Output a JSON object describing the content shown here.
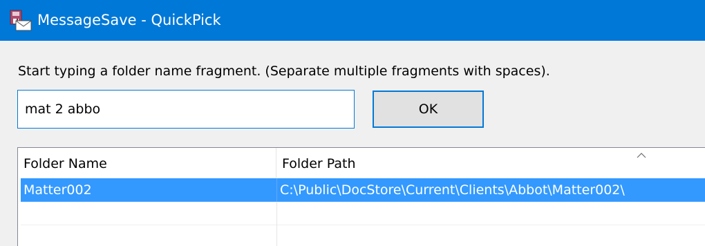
{
  "window": {
    "title": "MessageSave - QuickPick",
    "app_icon": "messagesave-envelope-icon"
  },
  "instruction": "Start typing a folder name fragment. (Separate multiple fragments with spaces).",
  "search": {
    "value": "mat 2 abbo",
    "placeholder": ""
  },
  "ok_button": {
    "label": "OK"
  },
  "list": {
    "columns": [
      {
        "label": "Folder Name"
      },
      {
        "label": "Folder Path"
      }
    ],
    "sort_icon": "sort-ascending-chevron-icon",
    "rows": [
      {
        "name": "Matter002",
        "path": "C:\\Public\\DocStore\\Current\\Clients\\Abbot\\Matter002\\",
        "selected": true
      }
    ]
  },
  "colors": {
    "titlebar": "#0078d7",
    "selection": "#3399ff",
    "focus_border": "#0078d7",
    "background": "#f0f0f0"
  }
}
